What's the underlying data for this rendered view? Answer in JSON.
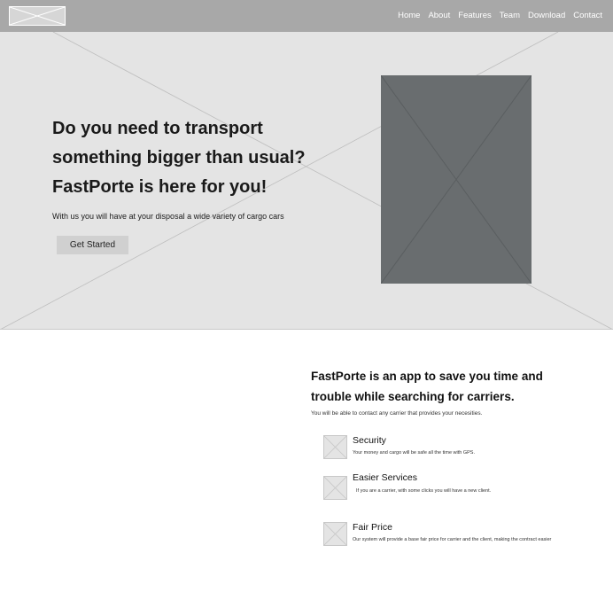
{
  "nav": {
    "logo": "logo-placeholder",
    "items": [
      {
        "label": "Home"
      },
      {
        "label": "About"
      },
      {
        "label": "Features"
      },
      {
        "label": "Team"
      },
      {
        "label": "Download"
      },
      {
        "label": "Contact"
      }
    ]
  },
  "hero": {
    "title_lines": [
      "Do you need to transport",
      "something bigger than usual?",
      "FastPorte is here for you!"
    ],
    "subtitle": "With us you will have at your disposal a wide variety of cargo cars",
    "cta_label": "Get Started",
    "image": "image-placeholder"
  },
  "about": {
    "title_lines": [
      "FastPorte is an app to save you time and",
      "trouble while searching for carriers."
    ],
    "subtitle": "You will be able to contact any carrier that provides your necesities.",
    "features": [
      {
        "title": "Security",
        "description": "Your money and cargo will be safe all the time with GPS.",
        "icon": "image-placeholder-icon"
      },
      {
        "title": "Easier Services",
        "description": "If you are a carrier, with some clicks you will have a new client.",
        "icon": "image-placeholder-icon"
      },
      {
        "title": "Fair Price",
        "description": "Our system will provide a base fair price for carrier and the client, making the contract easier",
        "icon": "image-placeholder-icon"
      }
    ]
  },
  "colors": {
    "topbar": "#a8a8a8",
    "hero_bg": "#e4e4e4",
    "hero_image": "#696d6f",
    "button": "#d0d0d0"
  }
}
